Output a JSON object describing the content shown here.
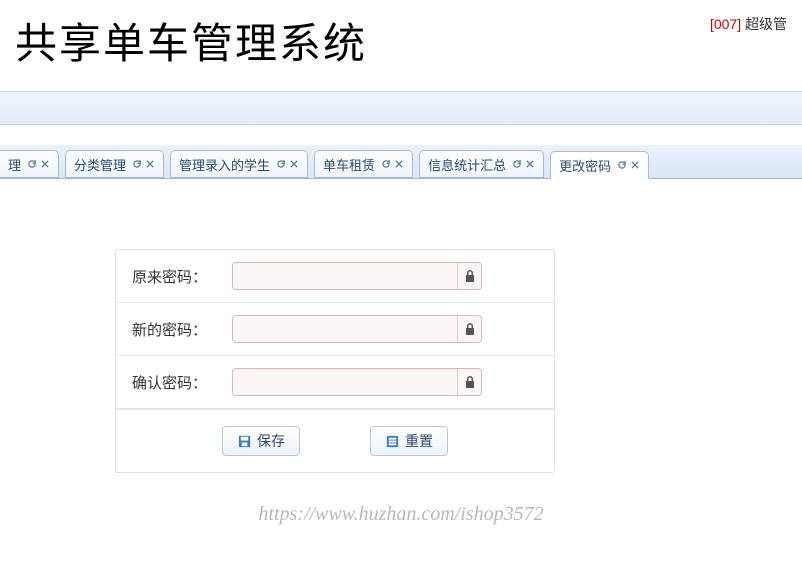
{
  "header": {
    "title": "共享单车管理系统",
    "user_code": "[007]",
    "user_role": "超级管"
  },
  "tabs": [
    {
      "label": "理"
    },
    {
      "label": "分类管理"
    },
    {
      "label": "管理录入的学生"
    },
    {
      "label": "单车租赁"
    },
    {
      "label": "信息统计汇总"
    },
    {
      "label": "更改密码"
    }
  ],
  "form": {
    "old_pwd_label": "原来密码：",
    "new_pwd_label": "新的密码：",
    "confirm_pwd_label": "确认密码：",
    "save_label": "保存",
    "reset_label": "重置"
  },
  "watermark": "https://www.huzhan.com/ishop3572"
}
